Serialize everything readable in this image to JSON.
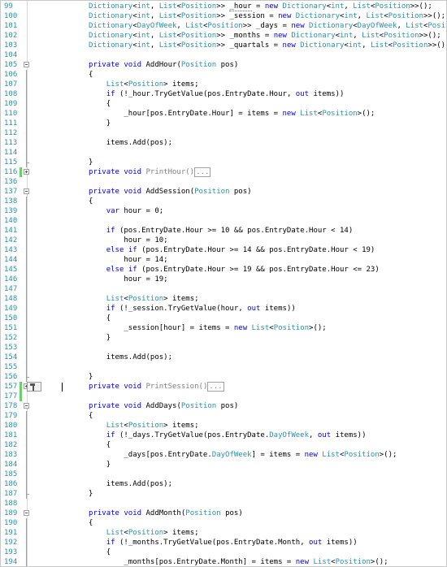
{
  "editor": {
    "lines": [
      {
        "ln": "99",
        "code": "            Dictionary<int, List<Position>> _hour = new Dictionary<int, List<Position>>();"
      },
      {
        "ln": "100",
        "code": "            Dictionary<int, List<Position>> _session = new Dictionary<int, List<Position>>();"
      },
      {
        "ln": "101",
        "code": "            Dictionary<DayOfWeek, List<Position>> _days = new Dictionary<DayOfWeek, List<Position>>();"
      },
      {
        "ln": "102",
        "code": "            Dictionary<int, List<Position>> _months = new Dictionary<int, List<Position>>();"
      },
      {
        "ln": "103",
        "code": "            Dictionary<int, List<Position>> _quartals = new Dictionary<int, List<Position>>();"
      },
      {
        "ln": "104",
        "code": ""
      },
      {
        "ln": "105",
        "code": "            private void AddHour(Position pos)"
      },
      {
        "ln": "106",
        "code": "            {"
      },
      {
        "ln": "107",
        "code": "                List<Position> items;"
      },
      {
        "ln": "108",
        "code": "                if (!_hour.TryGetValue(pos.EntryDate.Hour, out items))"
      },
      {
        "ln": "109",
        "code": "                {"
      },
      {
        "ln": "110",
        "code": "                    _hour[pos.EntryDate.Hour] = items = new List<Position>();"
      },
      {
        "ln": "111",
        "code": "                }"
      },
      {
        "ln": "112",
        "code": ""
      },
      {
        "ln": "113",
        "code": "                items.Add(pos);"
      },
      {
        "ln": "114",
        "code": ""
      },
      {
        "ln": "115",
        "code": "            }"
      },
      {
        "ln": "116",
        "code": "            private void PrintHour()"
      },
      {
        "ln": "136",
        "code": ""
      },
      {
        "ln": "137",
        "code": "            private void AddSession(Position pos)"
      },
      {
        "ln": "138",
        "code": "            {"
      },
      {
        "ln": "139",
        "code": "                var hour = 0;"
      },
      {
        "ln": "140",
        "code": ""
      },
      {
        "ln": "141",
        "code": "                if (pos.EntryDate.Hour >= 10 && pos.EntryDate.Hour < 14)"
      },
      {
        "ln": "142",
        "code": "                    hour = 10;"
      },
      {
        "ln": "143",
        "code": "                else if (pos.EntryDate.Hour >= 14 && pos.EntryDate.Hour < 19)"
      },
      {
        "ln": "144",
        "code": "                    hour = 14;"
      },
      {
        "ln": "145",
        "code": "                else if (pos.EntryDate.Hour >= 19 && pos.EntryDate.Hour <= 23)"
      },
      {
        "ln": "146",
        "code": "                    hour = 19;"
      },
      {
        "ln": "147",
        "code": ""
      },
      {
        "ln": "148",
        "code": "                List<Position> items;"
      },
      {
        "ln": "149",
        "code": "                if (!_session.TryGetValue(hour, out items))"
      },
      {
        "ln": "150",
        "code": "                {"
      },
      {
        "ln": "151",
        "code": "                    _session[hour] = items = new List<Position>();"
      },
      {
        "ln": "152",
        "code": "                }"
      },
      {
        "ln": "153",
        "code": ""
      },
      {
        "ln": "154",
        "code": "                items.Add(pos);"
      },
      {
        "ln": "155",
        "code": ""
      },
      {
        "ln": "156",
        "code": "            }"
      },
      {
        "ln": "157",
        "code": "            private void PrintSession()"
      },
      {
        "ln": "177",
        "code": ""
      },
      {
        "ln": "178",
        "code": "            private void AddDays(Position pos)"
      },
      {
        "ln": "179",
        "code": "            {"
      },
      {
        "ln": "180",
        "code": "                List<Position> items;"
      },
      {
        "ln": "181",
        "code": "                if (!_days.TryGetValue(pos.EntryDate.DayOfWeek, out items))"
      },
      {
        "ln": "182",
        "code": "                {"
      },
      {
        "ln": "183",
        "code": "                    _days[pos.EntryDate.DayOfWeek] = items = new List<Position>();"
      },
      {
        "ln": "184",
        "code": "                }"
      },
      {
        "ln": "185",
        "code": ""
      },
      {
        "ln": "186",
        "code": "                items.Add(pos);"
      },
      {
        "ln": "187",
        "code": "            }"
      },
      {
        "ln": "188",
        "code": ""
      },
      {
        "ln": "189",
        "code": "            private void AddMonth(Position pos)"
      },
      {
        "ln": "190",
        "code": "            {"
      },
      {
        "ln": "191",
        "code": "                List<Position> items;"
      },
      {
        "ln": "192",
        "code": "                if (!_months.TryGetValue(pos.EntryDate.Month, out items))"
      },
      {
        "ln": "193",
        "code": "                {"
      },
      {
        "ln": "194",
        "code": "                    _months[pos.EntryDate.Month] = items = new List<Position>();"
      }
    ],
    "collapsed_marker": "...",
    "smart_tag_icon": "hammer-icon",
    "colors": {
      "keyword": "#0000ff",
      "type": "#2b91af",
      "line_number": "#2b91af",
      "collapsed_text": "#808080",
      "change_bar": "#6ccf6c"
    }
  }
}
